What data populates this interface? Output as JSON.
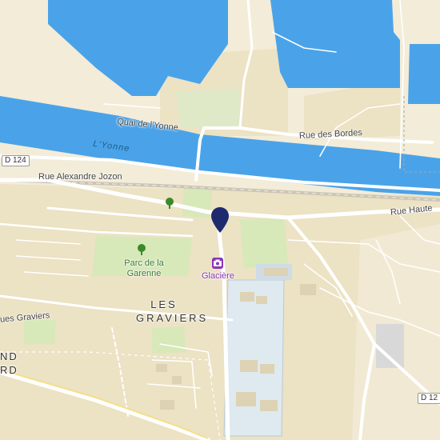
{
  "map": {
    "colors": {
      "land": "#f3ecd8",
      "water": "#4aa3e8",
      "urban": "#ece2c4",
      "park": "#d7e8b9",
      "road": "#ffffff",
      "marker": "#1e2a6e",
      "poi": "#8a35b8",
      "sports": "#dfeaf0"
    },
    "labels": {
      "quai_yonne": "Quai de l'Yonne",
      "rue_bordes": "Rue des Bordes",
      "river": "L'Yonne",
      "d124_left": "D 124",
      "rue_jozon": "Rue Alexandre Jozon",
      "rue_haute": "Rue Haute",
      "park": "Parc de la Garenne",
      "poi": "Glacière",
      "district": "LES GRAVIERS",
      "rue_graviers": "ues Graviers",
      "partial_top": "ND",
      "partial_bottom": "RD",
      "d12_right": "D 12"
    },
    "icons": {
      "marker": "location-pin-icon",
      "poi": "camera-icon",
      "tree": "tree-icon"
    }
  }
}
